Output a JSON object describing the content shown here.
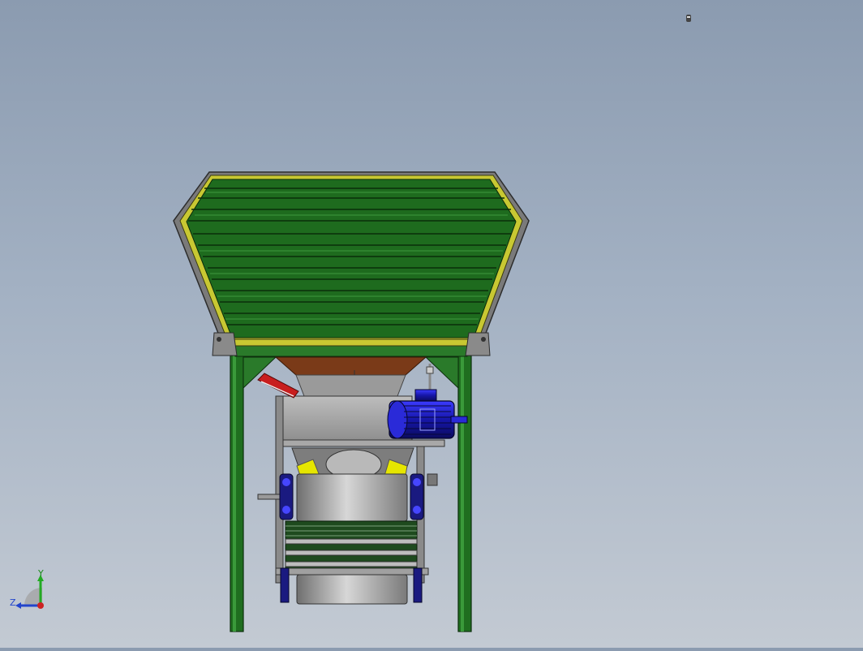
{
  "viewport": {
    "background_top": "#8b9bb0",
    "background_bottom": "#c3cad3",
    "top_right_icon": "light-bulb-icon"
  },
  "model": {
    "hopper_color": "#1e6b1e",
    "hopper_trim_color": "#c8c832",
    "frame_color": "#2a7a2a",
    "motor_color": "#1a1aa8",
    "chute_color": "#a0a0a0",
    "belt_color": "#2d5a2d",
    "accent_yellow": "#e6e600",
    "accent_red": "#c81e1e"
  },
  "triad": {
    "x_label": "",
    "y_label": "Y",
    "z_label": "Z",
    "y_color": "#22aa22",
    "z_color": "#2244cc",
    "x_color": "#cc2222"
  }
}
